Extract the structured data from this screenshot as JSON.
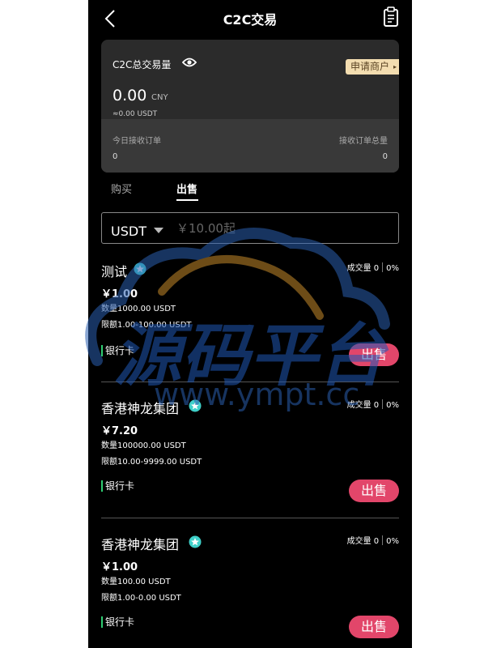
{
  "header": {
    "title": "C2C交易"
  },
  "summary": {
    "label": "C2C总交易量",
    "merchant_button": "申请商户",
    "amount": "0.00",
    "currency": "CNY",
    "approx": "≈0.00 USDT",
    "today_label": "今日接收订单",
    "today_value": "0",
    "total_label": "接收订单总量",
    "total_value": "0"
  },
  "tabs": [
    {
      "label": "购买",
      "active": false
    },
    {
      "label": "出售",
      "active": true
    }
  ],
  "filter": {
    "coin": "USDT",
    "placeholder": "￥10.00起"
  },
  "listings": [
    {
      "seller": "测试",
      "volume": "成交量 0",
      "rate": "0%",
      "price": "￥1.00",
      "quantity": "数量1000.00 USDT",
      "limit": "限额1.00-100.00 USDT",
      "payment": "银行卡",
      "action": "出售"
    },
    {
      "seller": "香港神龙集团",
      "volume": "成交量 0",
      "rate": "0%",
      "price": "￥7.20",
      "quantity": "数量100000.00 USDT",
      "limit": "限额10.00-9999.00 USDT",
      "payment": "银行卡",
      "action": "出售"
    },
    {
      "seller": "香港神龙集团",
      "volume": "成交量 0",
      "rate": "0%",
      "price": "￥1.00",
      "quantity": "数量100.00 USDT",
      "limit": "限额1.00-0.00 USDT",
      "payment": "银行卡",
      "action": "出售"
    }
  ],
  "watermark": {
    "brand": "源码平台",
    "url": "www.ympt.cc"
  },
  "colors": {
    "background": "#000000",
    "card": "#2b2b2b",
    "merchant": "#f3ddb0",
    "sell": "#e2466a",
    "payment_bar": "#2ecc71",
    "verified": "#3fd0c9"
  },
  "icons": {
    "back": "chevron-left-icon",
    "orders": "clipboard-icon",
    "eye": "eye-icon",
    "verified": "verified-badge-icon",
    "dropdown": "caret-down-icon"
  }
}
